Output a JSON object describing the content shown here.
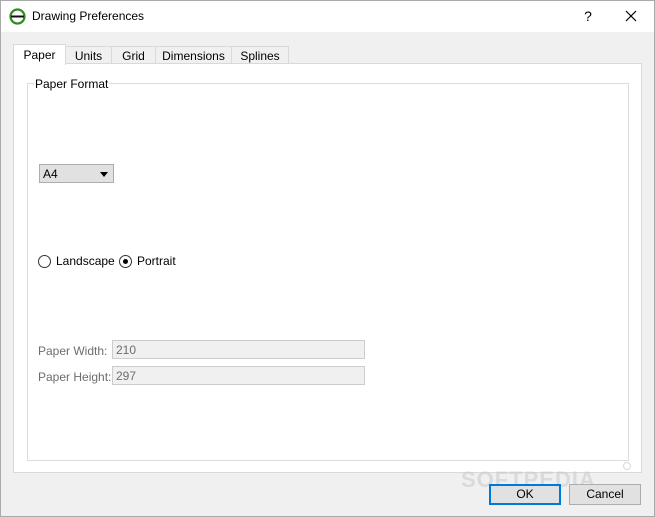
{
  "window": {
    "title": "Drawing Preferences",
    "help_label": "?",
    "accent_color": "#0078d7",
    "app_icon_color": "#2e8b1e"
  },
  "tabs": [
    {
      "label": "Paper",
      "active": true
    },
    {
      "label": "Units",
      "active": false
    },
    {
      "label": "Grid",
      "active": false
    },
    {
      "label": "Dimensions",
      "active": false
    },
    {
      "label": "Splines",
      "active": false
    }
  ],
  "paper_format": {
    "group_title": "Paper Format",
    "format_select": {
      "selected": "A4"
    },
    "orientation": {
      "landscape_label": "Landscape",
      "portrait_label": "Portrait",
      "selected": "Portrait"
    },
    "width": {
      "label": "Paper Width:",
      "value": "210"
    },
    "height": {
      "label": "Paper Height:",
      "value": "297"
    }
  },
  "buttons": {
    "ok_label": "OK",
    "cancel_label": "Cancel"
  },
  "watermark": {
    "text": "SOFTPEDIA"
  }
}
